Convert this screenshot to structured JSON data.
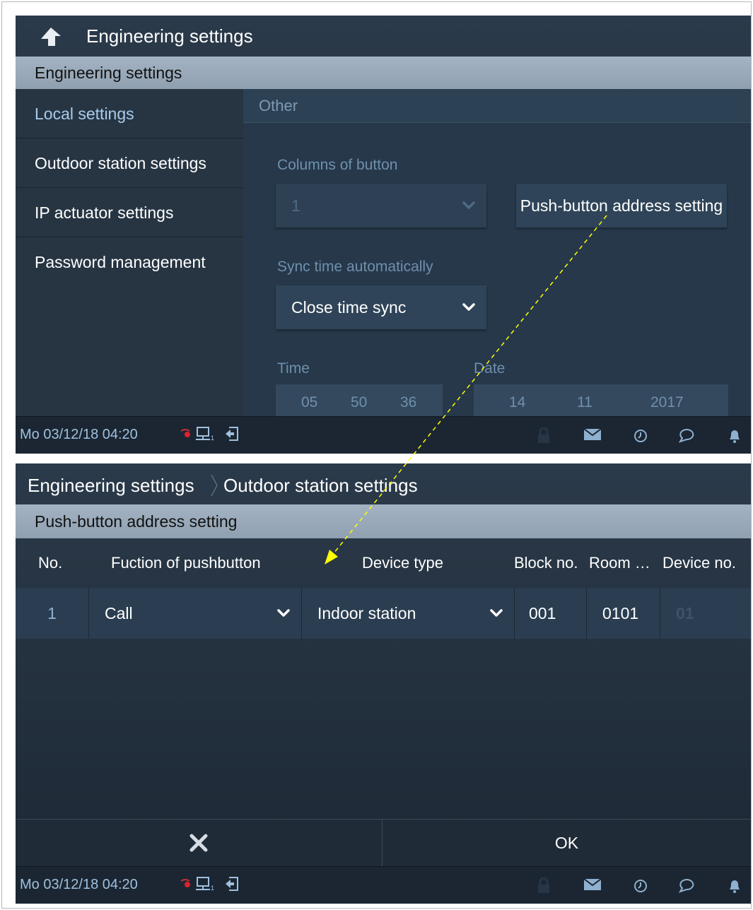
{
  "screen1": {
    "title": "Engineering settings",
    "section_header": "Engineering settings",
    "sidebar": [
      {
        "label": "Local settings"
      },
      {
        "label": "Outdoor station settings"
      },
      {
        "label": "IP actuator settings"
      },
      {
        "label": "Password management"
      }
    ],
    "content": {
      "section": "Other",
      "columns_label": "Columns of button",
      "columns_value": "1",
      "push_button_label": "Push-button address setting",
      "sync_label": "Sync time automatically",
      "sync_value": "Close time sync",
      "time_label": "Time",
      "date_label": "Date",
      "time": {
        "h": "05",
        "m": "50",
        "s": "36"
      },
      "date": {
        "d": "14",
        "mo": "11",
        "y": "2017"
      }
    },
    "status": {
      "datetime": "Mo 03/12/18  04:20"
    }
  },
  "screen2": {
    "breadcrumb": [
      "Engineering settings",
      "Outdoor station settings"
    ],
    "section_header": "Push-button address setting",
    "columns": [
      "No.",
      "Fuction of pushbutton",
      "Device type",
      "Block no.",
      "Room …",
      "Device no."
    ],
    "rows": [
      {
        "no": "1",
        "function": "Call",
        "device_type": "Indoor station",
        "block": "001",
        "room": "0101",
        "device": "01"
      }
    ],
    "cancel_icon": "close-icon",
    "ok_label": "OK",
    "status": {
      "datetime": "Mo 03/12/18  04:20"
    }
  },
  "colors": {
    "panel": "#24313f",
    "header_bar": "#94a5b6",
    "accent_blue": "#a9cbea",
    "dim_text": "#6f90ad",
    "arrow": "#ffff00"
  }
}
